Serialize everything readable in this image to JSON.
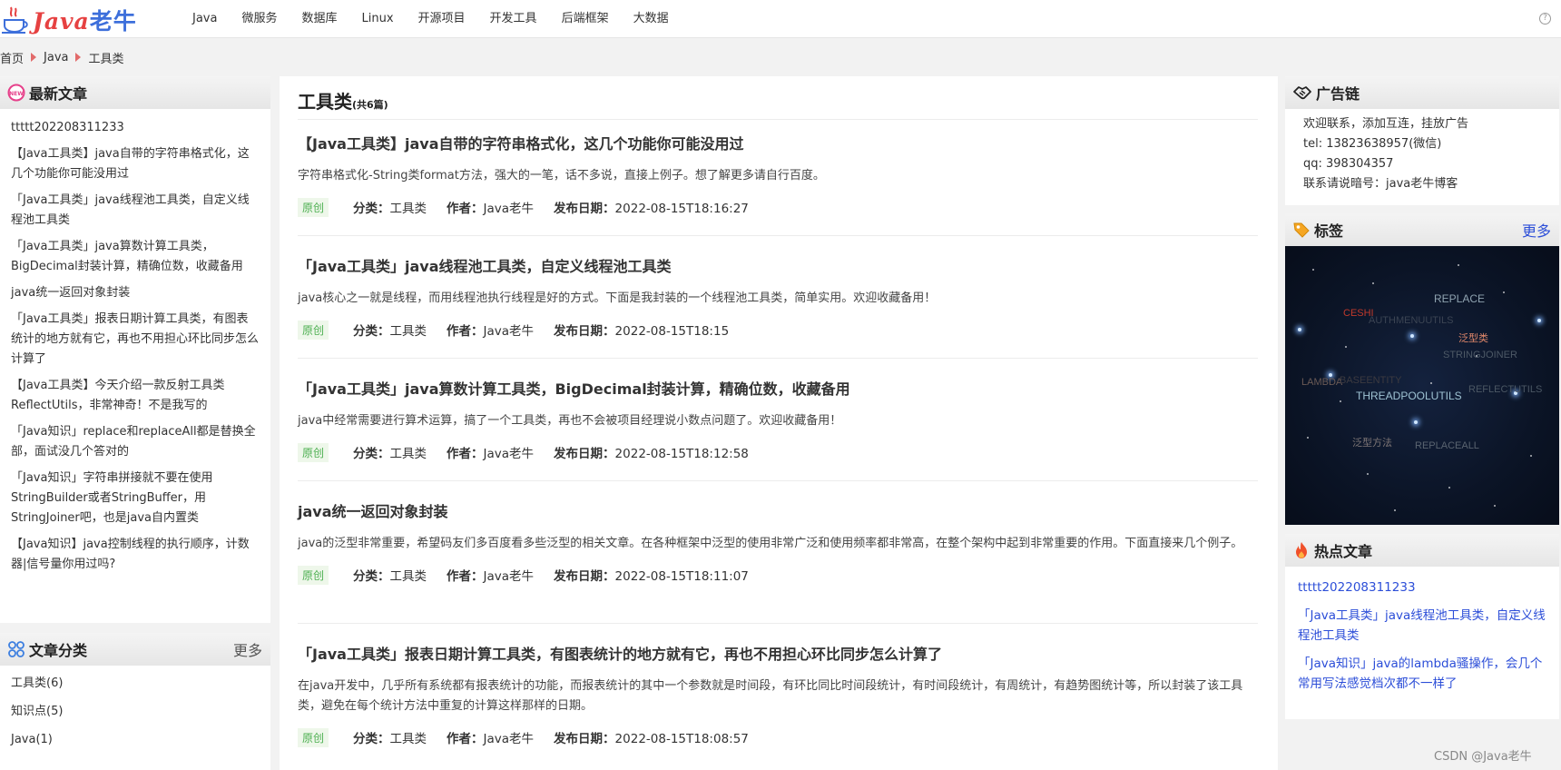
{
  "site": {
    "logo_latin": "Java",
    "logo_cn": "老牛",
    "nav": [
      "Java",
      "微服务",
      "数据库",
      "Linux",
      "开源项目",
      "开发工具",
      "后端框架",
      "大数据"
    ]
  },
  "breadcrumb": [
    "首页",
    "Java",
    "工具类"
  ],
  "latest": {
    "title": "最新文章",
    "items": [
      "ttttt202208311233",
      "【Java工具类】java自带的字符串格式化，这几个功能你可能没用过",
      "「Java工具类」java线程池工具类，自定义线程池工具类",
      "「Java工具类」java算数计算工具类，BigDecimal封装计算，精确位数，收藏备用",
      "java统一返回对象封装",
      "「Java工具类」报表日期计算工具类，有图表统计的地方就有它，再也不用担心环比同步怎么计算了",
      "【Java工具类】今天介绍一款反射工具类ReflectUtils，非常神奇！不是我写的",
      "「Java知识」replace和replaceAll都是替换全部，面试没几个答对的",
      "「Java知识」字符串拼接就不要在使用StringBuilder或者StringBuffer，用StringJoiner吧，也是java自内置类",
      "【Java知识】java控制线程的执行顺序，计数器|信号量你用过吗?"
    ]
  },
  "categories": {
    "title": "文章分类",
    "more": "更多",
    "items": [
      "工具类(6)",
      "知识点(5)",
      "Java(1)"
    ]
  },
  "main": {
    "title": "工具类",
    "count": "(共6篇)",
    "meta_labels": {
      "category": "分类：",
      "author": "作者：",
      "date": "发布日期："
    },
    "articles": [
      {
        "title": "【Java工具类】java自带的字符串格式化，这几个功能你可能没用过",
        "summary": "字符串格式化-String类format方法，强大的一笔，话不多说，直接上例子。想了解更多请自行百度。",
        "tag": "原创",
        "category": "工具类",
        "author": "Java老牛",
        "date": "2022-08-15T18:16:27"
      },
      {
        "title": "「Java工具类」java线程池工具类，自定义线程池工具类",
        "summary": "java核心之一就是线程，而用线程池执行线程是好的方式。下面是我封装的一个线程池工具类，简单实用。欢迎收藏备用！",
        "tag": "原创",
        "category": "工具类",
        "author": "Java老牛",
        "date": "2022-08-15T18:15"
      },
      {
        "title": "「Java工具类」java算数计算工具类，BigDecimal封装计算，精确位数，收藏备用",
        "summary": "java中经常需要进行算术运算，搞了一个工具类，再也不会被项目经理说小数点问题了。欢迎收藏备用！",
        "tag": "原创",
        "category": "工具类",
        "author": "Java老牛",
        "date": "2022-08-15T18:12:58"
      },
      {
        "title": "java统一返回对象封装",
        "summary": "java的泛型非常重要，希望码友们多百度看多些泛型的相关文章。在各种框架中泛型的使用非常广泛和使用频率都非常高，在整个架构中起到非常重要的作用。下面直接来几个例子。",
        "tag": "原创",
        "category": "工具类",
        "author": "Java老牛",
        "date": "2022-08-15T18:11:07"
      },
      {
        "title": "「Java工具类」报表日期计算工具类，有图表统计的地方就有它，再也不用担心环比同步怎么计算了",
        "summary": "在java开发中，几乎所有系统都有报表统计的功能，而报表统计的其中一个参数就是时间段，有环比同比时间段统计，有时间段统计，有周统计，有趋势图统计等，所以封装了该工具类，避免在每个统计方法中重复的计算这样那样的日期。",
        "tag": "原创",
        "category": "工具类",
        "author": "Java老牛",
        "date": "2022-08-15T18:08:57"
      }
    ]
  },
  "ads": {
    "title": "广告链",
    "lines": [
      "欢迎联系，添加互连，挂放广告",
      "tel: 13823638957(微信)",
      "qq: 398304357",
      "联系请说暗号：java老牛博客"
    ]
  },
  "tags": {
    "title": "标签",
    "more": "更多",
    "cloud": [
      {
        "text": "REPLACE",
        "color": "#8fa3b0"
      },
      {
        "text": "CESHI",
        "color": "#c0392b"
      },
      {
        "text": "AUTHMENUUTILS",
        "color": "#3b4453"
      },
      {
        "text": "泛型类",
        "color": "#e0876a"
      },
      {
        "text": "STRINGJOINER",
        "color": "#4d5966"
      },
      {
        "text": "LAMBDA",
        "color": "#6b5a55"
      },
      {
        "text": "BASEENTITY",
        "color": "#3c3a40"
      },
      {
        "text": "REFLECTUTILS",
        "color": "#4b5764"
      },
      {
        "text": "THREADPOOLUTILS",
        "color": "#9fc3d4"
      },
      {
        "text": "泛型方法",
        "color": "#7d7575"
      },
      {
        "text": "REPLACEALL",
        "color": "#5a6470"
      }
    ]
  },
  "hot": {
    "title": "热点文章",
    "items": [
      "ttttt202208311233",
      "「Java工具类」java线程池工具类，自定义线程池工具类",
      "「Java知识」java的lambda骚操作，会几个常用写法感觉档次都不一样了"
    ]
  },
  "watermark": "CSDN @Java老牛",
  "colors": {
    "accent_red": "#e64141",
    "link_blue": "#2c4ed8",
    "original_green": "#4caf50"
  }
}
